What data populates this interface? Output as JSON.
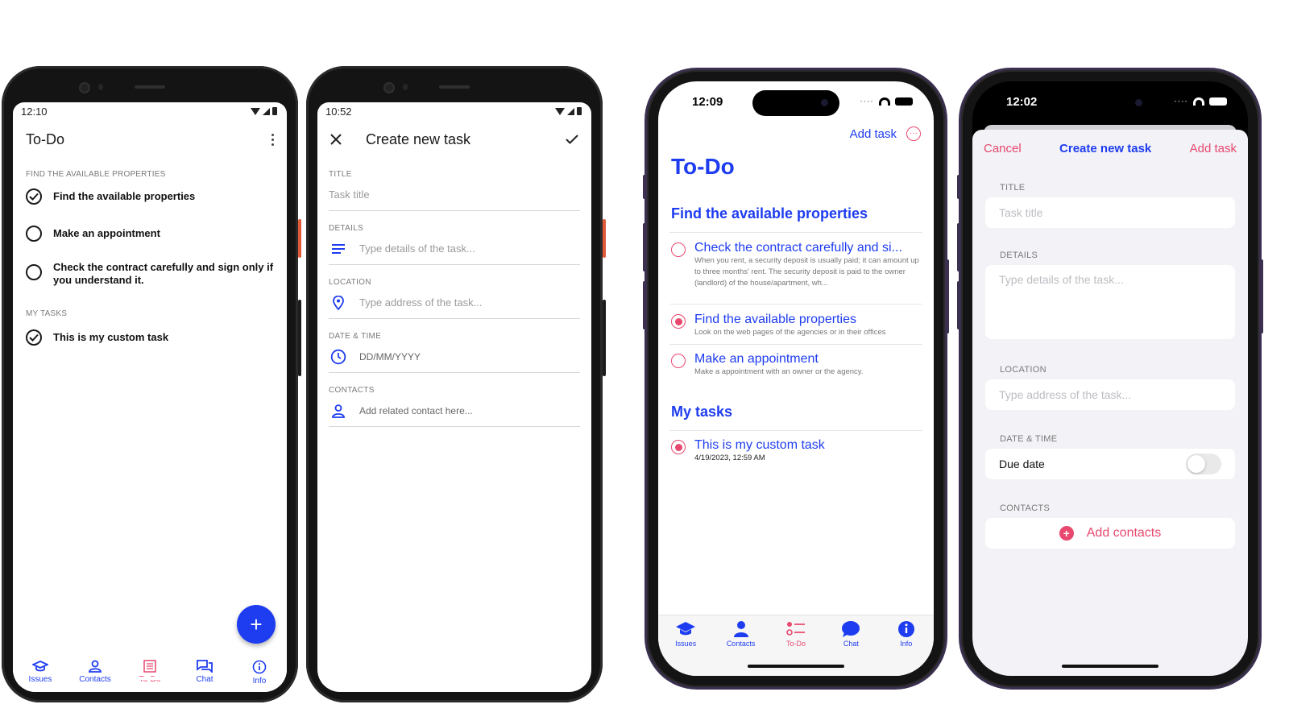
{
  "colors": {
    "accent": "#1e3cf0",
    "pink": "#e8486e"
  },
  "tabs": [
    {
      "label": "Issues",
      "icon": "graduation-cap-icon"
    },
    {
      "label": "Contacts",
      "icon": "person-icon"
    },
    {
      "label": "To-Do",
      "icon": "checklist-icon"
    },
    {
      "label": "Chat",
      "icon": "chat-icon"
    },
    {
      "label": "Info",
      "icon": "info-icon"
    }
  ],
  "android_list": {
    "time": "12:10",
    "title": "To-Do",
    "section1": "FIND THE AVAILABLE PROPERTIES",
    "items": [
      "Find the available properties",
      "Make an appointment",
      "Check the contract carefully and sign only if you understand it."
    ],
    "section2": "MY TASKS",
    "custom_item": "This is my custom task",
    "fab": "+"
  },
  "android_create": {
    "time": "10:52",
    "title": "Create new task",
    "title_label": "TITLE",
    "title_placeholder": "Task title",
    "details_label": "DETAILS",
    "details_placeholder": "Type details of the task...",
    "location_label": "LOCATION",
    "location_placeholder": "Type address of the task...",
    "datetime_label": "DATE & TIME",
    "datetime_placeholder": "DD/MM/YYYY",
    "contacts_label": "CONTACTS",
    "contacts_placeholder": "Add related contact here..."
  },
  "ios_list": {
    "time": "12:09",
    "add_task": "Add task",
    "title": "To-Do",
    "section1": "Find the available properties",
    "tasks": [
      {
        "title": "Check the contract carefully and si...",
        "sub": "When you rent, a security deposit is usually paid; it can amount up to three months' rent. The security deposit is paid to the owner (landlord) of the house/apartment, wh..."
      },
      {
        "title": "Find the available properties",
        "sub": "Look on the web pages of the agencies or in their offices"
      },
      {
        "title": "Make an appointment",
        "sub": "Make a appointment with an owner or the agency."
      }
    ],
    "section2": "My tasks",
    "custom": {
      "title": "This is my custom task",
      "sub": "4/19/2023, 12:59 AM"
    }
  },
  "ios_create": {
    "time": "12:02",
    "cancel": "Cancel",
    "title": "Create new task",
    "add": "Add task",
    "title_label": "TITLE",
    "title_placeholder": "Task title",
    "details_label": "DETAILS",
    "details_placeholder": "Type details of the task...",
    "location_label": "LOCATION",
    "location_placeholder": "Type address of the task...",
    "datetime_label": "DATE & TIME",
    "due_date": "Due date",
    "contacts_label": "CONTACTS",
    "add_contacts": "Add contacts"
  }
}
